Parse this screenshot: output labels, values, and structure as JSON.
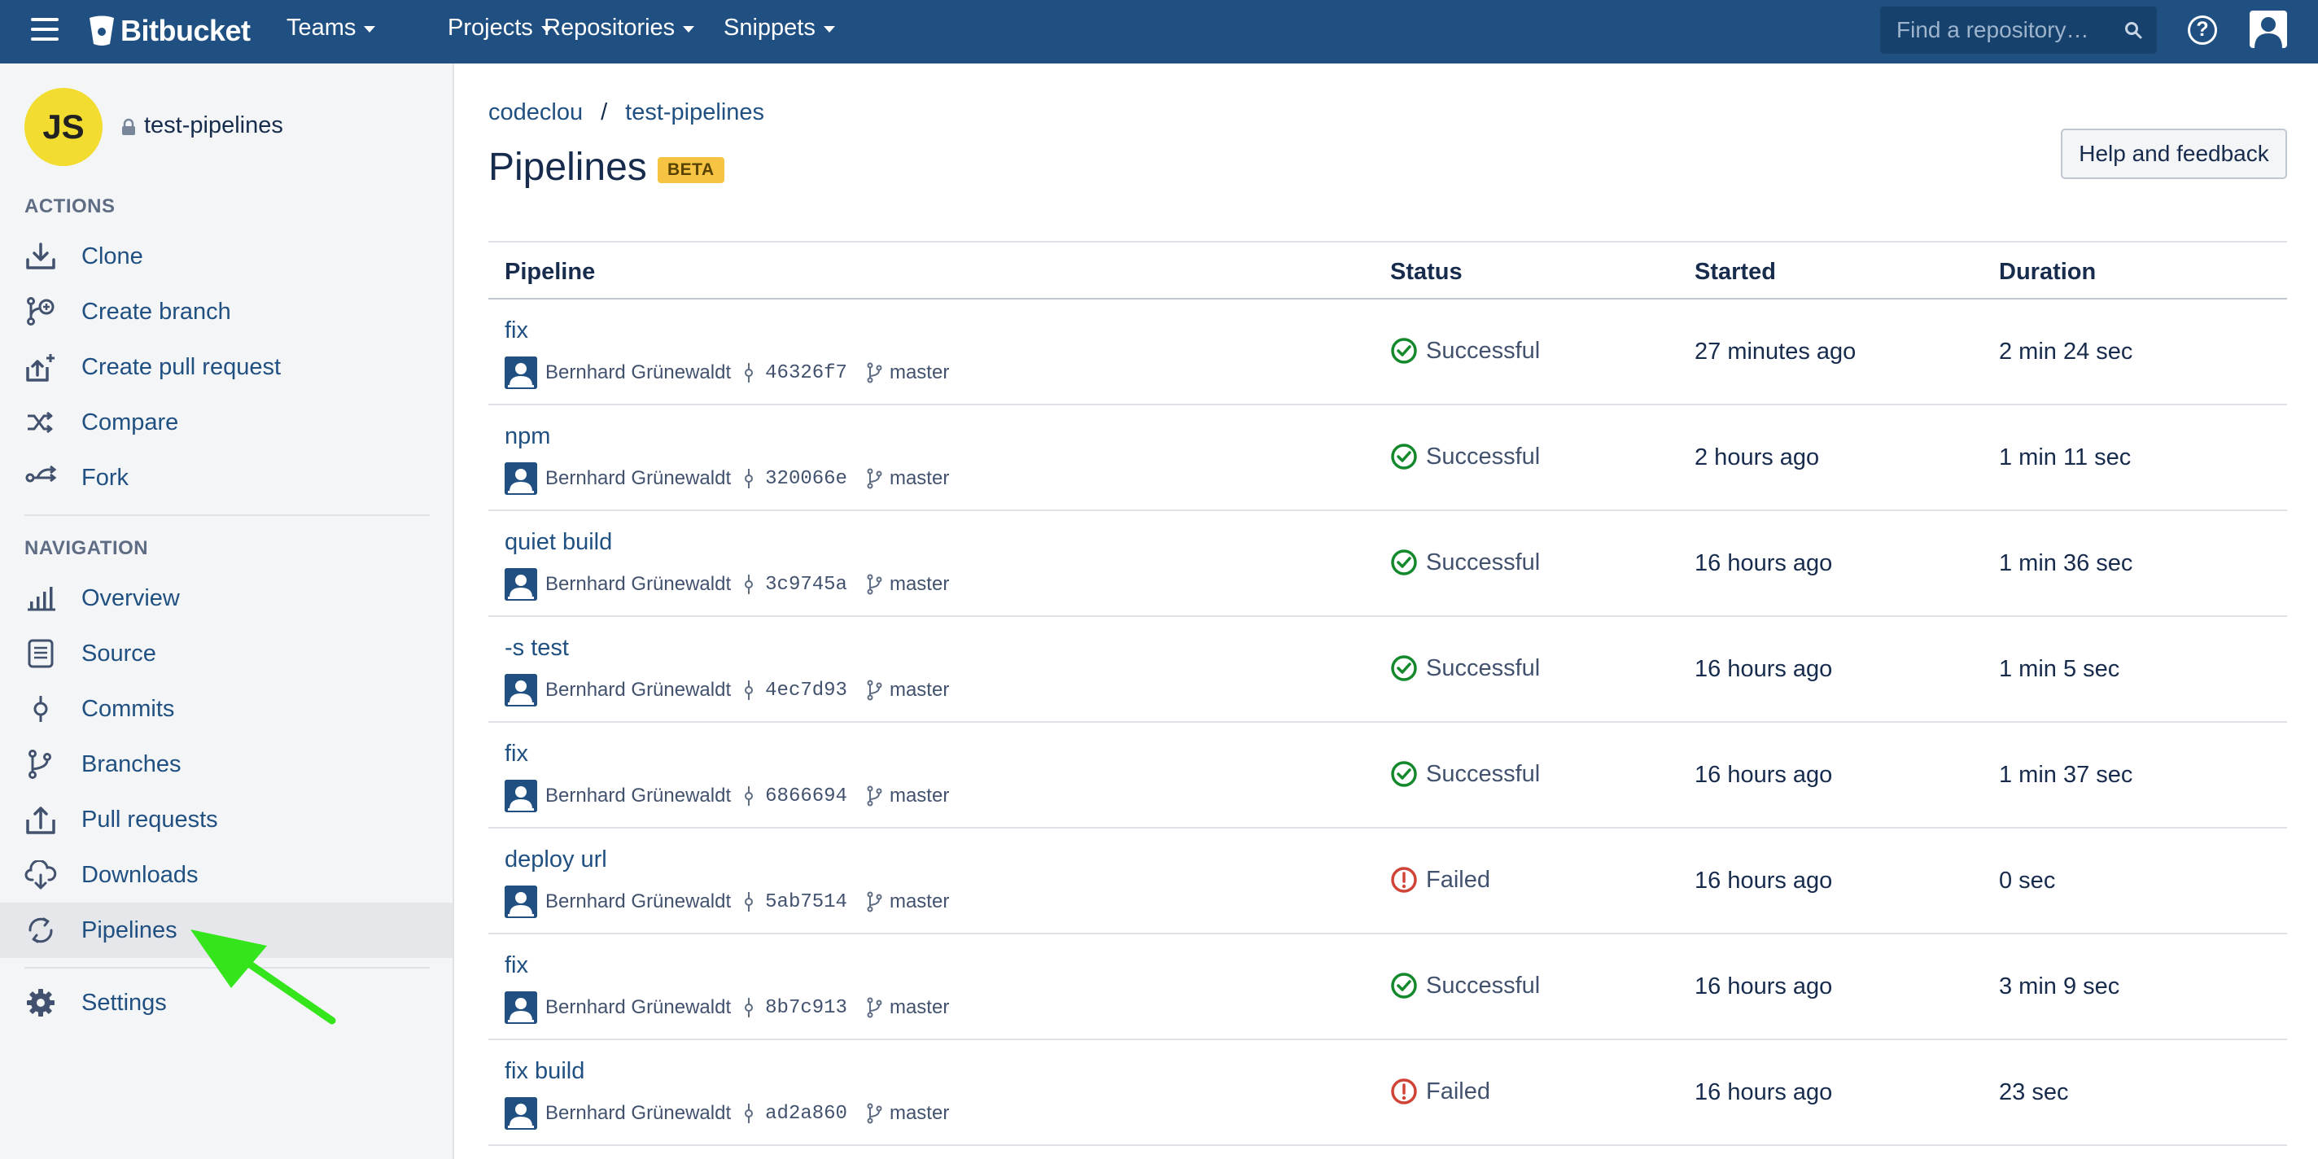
{
  "topbar": {
    "brand": "Bitbucket",
    "nav": [
      {
        "label": "Teams"
      },
      {
        "label": "Projects"
      },
      {
        "label": "Repositories"
      },
      {
        "label": "Snippets"
      }
    ],
    "search_placeholder": "Find a repository…",
    "help_glyph": "?"
  },
  "sidebar": {
    "avatar_initials": "JS",
    "repo_name": "test-pipelines",
    "actions_title": "ACTIONS",
    "actions": [
      {
        "label": "Clone",
        "icon": "download-icon"
      },
      {
        "label": "Create branch",
        "icon": "branch-plus-icon"
      },
      {
        "label": "Create pull request",
        "icon": "pull-request-plus-icon"
      },
      {
        "label": "Compare",
        "icon": "shuffle-icon"
      },
      {
        "label": "Fork",
        "icon": "fork-icon"
      }
    ],
    "navigation_title": "NAVIGATION",
    "navigation": [
      {
        "label": "Overview",
        "icon": "bar-chart-icon"
      },
      {
        "label": "Source",
        "icon": "document-icon"
      },
      {
        "label": "Commits",
        "icon": "commit-icon"
      },
      {
        "label": "Branches",
        "icon": "branch-icon"
      },
      {
        "label": "Pull requests",
        "icon": "pull-request-icon"
      },
      {
        "label": "Downloads",
        "icon": "cloud-download-icon"
      },
      {
        "label": "Pipelines",
        "icon": "refresh-icon",
        "active": true
      }
    ],
    "settings": {
      "label": "Settings",
      "icon": "gear-icon"
    }
  },
  "breadcrumb": {
    "owner": "codeclou",
    "separator": "/",
    "repo": "test-pipelines"
  },
  "page": {
    "title": "Pipelines",
    "badge": "BETA",
    "help_button": "Help and feedback"
  },
  "table": {
    "headers": {
      "pipeline": "Pipeline",
      "status": "Status",
      "started": "Started",
      "duration": "Duration"
    },
    "rows": [
      {
        "name": "fix",
        "author": "Bernhard Grünewaldt",
        "commit": "46326f7",
        "branch": "master",
        "status": "Successful",
        "started": "27 minutes ago",
        "duration": "2 min 24 sec"
      },
      {
        "name": "npm",
        "author": "Bernhard Grünewaldt",
        "commit": "320066e",
        "branch": "master",
        "status": "Successful",
        "started": "2 hours ago",
        "duration": "1 min 11 sec"
      },
      {
        "name": "quiet build",
        "author": "Bernhard Grünewaldt",
        "commit": "3c9745a",
        "branch": "master",
        "status": "Successful",
        "started": "16 hours ago",
        "duration": "1 min 36 sec"
      },
      {
        "name": "-s test",
        "author": "Bernhard Grünewaldt",
        "commit": "4ec7d93",
        "branch": "master",
        "status": "Successful",
        "started": "16 hours ago",
        "duration": "1 min 5 sec"
      },
      {
        "name": "fix",
        "author": "Bernhard Grünewaldt",
        "commit": "6866694",
        "branch": "master",
        "status": "Successful",
        "started": "16 hours ago",
        "duration": "1 min 37 sec"
      },
      {
        "name": "deploy url",
        "author": "Bernhard Grünewaldt",
        "commit": "5ab7514",
        "branch": "master",
        "status": "Failed",
        "started": "16 hours ago",
        "duration": "0 sec"
      },
      {
        "name": "fix",
        "author": "Bernhard Grünewaldt",
        "commit": "8b7c913",
        "branch": "master",
        "status": "Successful",
        "started": "16 hours ago",
        "duration": "3 min 9 sec"
      },
      {
        "name": "fix build",
        "author": "Bernhard Grünewaldt",
        "commit": "ad2a860",
        "branch": "master",
        "status": "Failed",
        "started": "16 hours ago",
        "duration": "23 sec"
      }
    ]
  },
  "colors": {
    "header_bg": "#205081",
    "link": "#205081",
    "success": "#14892c",
    "failed": "#d04437",
    "beta_bg": "#f6c342",
    "avatar_bg": "#f1dc2f",
    "arrow": "#33e51a"
  }
}
